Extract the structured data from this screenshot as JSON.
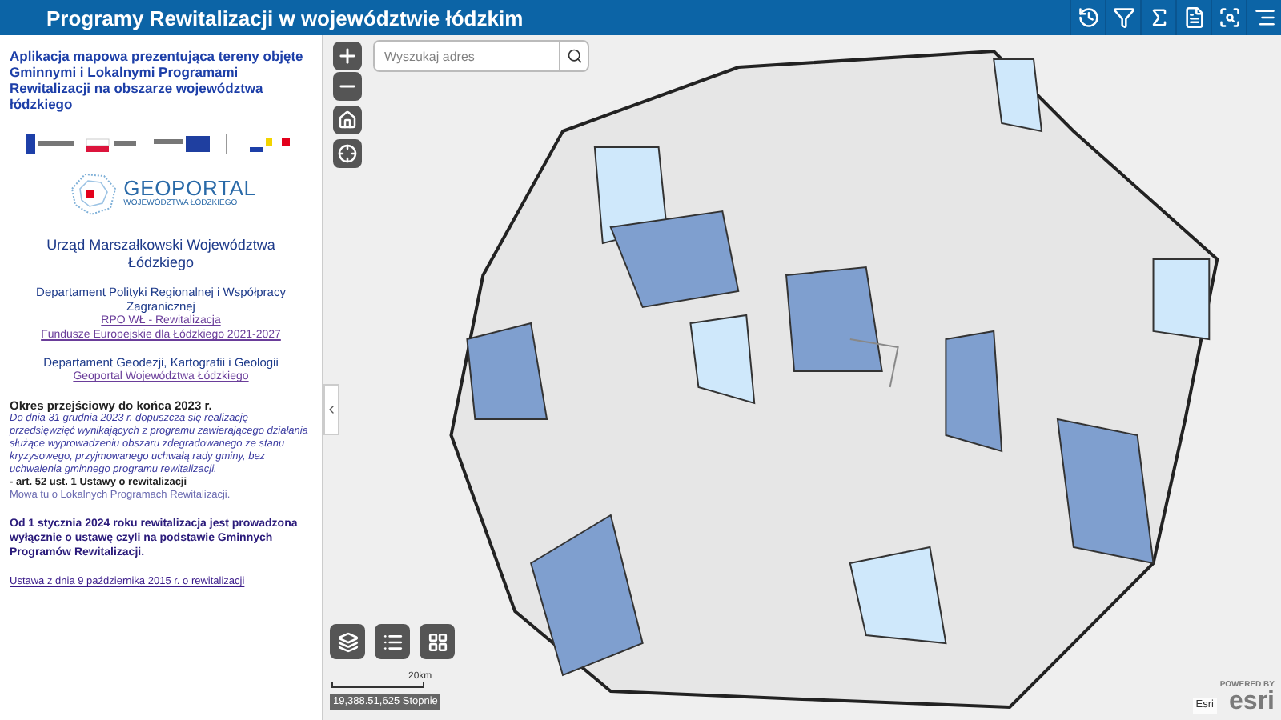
{
  "header": {
    "title": "Programy Rewitalizacji w województwie łódzkim"
  },
  "sidebar": {
    "intro": "Aplikacja mapowa prezentująca tereny objęte Gminnymi i Lokalnymi Programami Rewitalizacji na obszarze województwa łódzkiego",
    "geoportal_logo": {
      "name": "GEOPORTAL",
      "subtitle": "WOJEWÓDZTWA ŁÓDZKIEGO"
    },
    "office": "Urząd Marszałkowski Województwa Łódzkiego",
    "departments": [
      {
        "name": "Departament Polityki Regionalnej i Współpracy Zagranicznej",
        "links": [
          "RPO WŁ - Rewitalizacja",
          "Fundusze Europejskie dla Łódzkiego 2021-2027"
        ]
      },
      {
        "name": "Departament Geodezji, Kartografii i Geologii",
        "links": [
          "Geoportal Województwa Łódzkiego"
        ]
      }
    ],
    "transition_heading": "Okres przejściowy do końca 2023 r.",
    "transition_text": "Do dnia 31 grudnia 2023 r. dopuszcza się realizację przedsięwzięć wynikających z programu zawierającego działania służące wyprowadzeniu obszaru zdegradowanego ze stanu kryzysowego, przyjmowanego uchwałą rady gminy, bez uchwalenia gminnego programu rewitalizacji.",
    "transition_source": "- art. 52 ust. 1 Ustawy o rewitalizacji",
    "transition_note": "Mowa tu o Lokalnych Programach Rewitalizacji.",
    "notice": "Od 1 stycznia 2024 roku rewitalizacja jest prowadzona wyłącznie o ustawę czyli na podstawie Gminnych Programów Rewitalizacji.",
    "law_link": "Ustawa z dnia 9 października 2015 r. o rewitalizacji"
  },
  "map": {
    "search": {
      "placeholder": "Wyszukaj adres"
    },
    "scale": "20km",
    "coordinates": "19,388.51,625 Stopnie",
    "attribution": "Esri",
    "esri_logo": {
      "tagline": "POWERED BY",
      "name": "esri"
    }
  }
}
